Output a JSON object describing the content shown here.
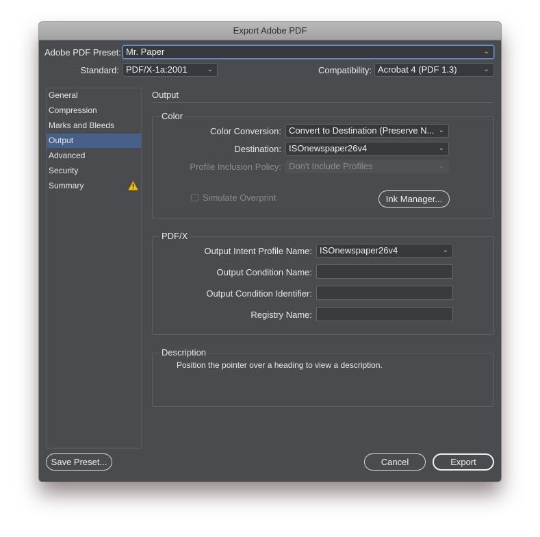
{
  "window": {
    "title": "Export Adobe PDF"
  },
  "header": {
    "preset_label": "Adobe PDF Preset:",
    "preset_value": "Mr. Paper",
    "standard_label": "Standard:",
    "standard_value": "PDF/X-1a:2001",
    "compatibility_label": "Compatibility:",
    "compatibility_value": "Acrobat 4 (PDF 1.3)"
  },
  "sidebar": {
    "items": [
      {
        "label": "General"
      },
      {
        "label": "Compression"
      },
      {
        "label": "Marks and Bleeds"
      },
      {
        "label": "Output",
        "active": true
      },
      {
        "label": "Advanced"
      },
      {
        "label": "Security"
      },
      {
        "label": "Summary",
        "icon": "warning-icon"
      }
    ]
  },
  "main": {
    "section_title": "Output",
    "color_group": {
      "title": "Color",
      "color_conversion_label": "Color Conversion:",
      "color_conversion_value": "Convert to Destination (Preserve N...",
      "destination_label": "Destination:",
      "destination_value": "ISOnewspaper26v4",
      "profile_policy_label": "Profile Inclusion Policy:",
      "profile_policy_value": "Don't Include Profiles",
      "simulate_overprint_label": "Simulate Overprint",
      "simulate_overprint_checked": false,
      "ink_manager_label": "Ink Manager..."
    },
    "pdfx_group": {
      "title": "PDF/X",
      "output_intent_label": "Output Intent Profile Name:",
      "output_intent_value": "ISOnewspaper26v4",
      "condition_name_label": "Output Condition Name:",
      "condition_name_value": "",
      "condition_identifier_label": "Output Condition Identifier:",
      "condition_identifier_value": "",
      "registry_name_label": "Registry Name:",
      "registry_name_value": ""
    },
    "description_group": {
      "title": "Description",
      "text": "Position the pointer over a heading to view a description."
    }
  },
  "footer": {
    "save_preset_label": "Save Preset...",
    "cancel_label": "Cancel",
    "export_label": "Export"
  },
  "icons": {
    "chevron": "⌄",
    "dropdown": "chevron-down-icon",
    "warning": "warning-icon"
  },
  "colors": {
    "accent_selection": "#46608a",
    "warning": "#f2c200",
    "background": "#4a4b4f"
  }
}
